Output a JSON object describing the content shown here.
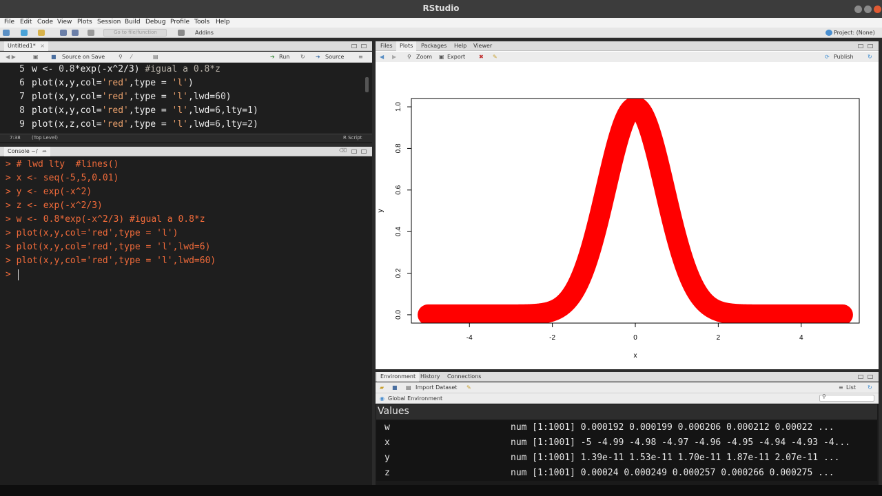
{
  "window": {
    "title": "RStudio"
  },
  "menu": [
    "File",
    "Edit",
    "Code",
    "View",
    "Plots",
    "Session",
    "Build",
    "Debug",
    "Profile",
    "Tools",
    "Help"
  ],
  "toolbar": {
    "goto_placeholder": "Go to file/function",
    "addins_label": "Addins",
    "project_label": "Project: (None)"
  },
  "editor": {
    "tab_label": "Untitled1*",
    "source_on_save_label": "Source on Save",
    "run_label": "Run",
    "source_label": "Source",
    "lines": [
      {
        "num": "5",
        "tokens": [
          {
            "t": "w <- ",
            "c": "kw"
          },
          {
            "t": "0.8",
            "c": "nm"
          },
          {
            "t": "*exp(-x^2/3) ",
            "c": "kw"
          },
          {
            "t": "#igual a 0.8*z",
            "c": "cm"
          }
        ]
      },
      {
        "num": "6",
        "tokens": [
          {
            "t": "plot(x,y,col=",
            "c": "kw"
          },
          {
            "t": "'red'",
            "c": "st"
          },
          {
            "t": ",type = ",
            "c": "kw"
          },
          {
            "t": "'l'",
            "c": "st"
          },
          {
            "t": ")",
            "c": "kw"
          }
        ]
      },
      {
        "num": "7",
        "tokens": [
          {
            "t": "plot(x,y,col=",
            "c": "kw"
          },
          {
            "t": "'red'",
            "c": "st"
          },
          {
            "t": ",type = ",
            "c": "kw"
          },
          {
            "t": "'l'",
            "c": "st"
          },
          {
            "t": ",lwd=",
            "c": "kw"
          },
          {
            "t": "60",
            "c": "nm"
          },
          {
            "t": ")",
            "c": "kw"
          }
        ]
      },
      {
        "num": "8",
        "tokens": [
          {
            "t": "plot(x,y,col=",
            "c": "kw"
          },
          {
            "t": "'red'",
            "c": "st"
          },
          {
            "t": ",type = ",
            "c": "kw"
          },
          {
            "t": "'l'",
            "c": "st"
          },
          {
            "t": ",lwd=",
            "c": "kw"
          },
          {
            "t": "6",
            "c": "nm"
          },
          {
            "t": ",lty=",
            "c": "kw"
          },
          {
            "t": "1",
            "c": "nm"
          },
          {
            "t": ")",
            "c": "kw"
          }
        ]
      },
      {
        "num": "9",
        "tokens": [
          {
            "t": "plot(x,z,col=",
            "c": "kw"
          },
          {
            "t": "'red'",
            "c": "st"
          },
          {
            "t": ",type = ",
            "c": "kw"
          },
          {
            "t": "'l'",
            "c": "st"
          },
          {
            "t": ",lwd=",
            "c": "kw"
          },
          {
            "t": "6",
            "c": "nm"
          },
          {
            "t": ",lty=",
            "c": "kw"
          },
          {
            "t": "2",
            "c": "nm"
          },
          {
            "t": ")",
            "c": "kw"
          }
        ]
      }
    ],
    "status_position": "7:38",
    "status_scope": "(Top Level)",
    "status_type": "R Script"
  },
  "console": {
    "tab_label": "Console ~/",
    "lines": [
      "> # lwd lty  #lines()",
      "> x <- seq(-5,5,0.01)",
      "> y <- exp(-x^2)",
      "> z <- exp(-x^2/3)",
      "> w <- 0.8*exp(-x^2/3) #igual a 0.8*z",
      "> plot(x,y,col='red',type = 'l')",
      "> plot(x,y,col='red',type = 'l',lwd=6)",
      "> plot(x,y,col='red',type = 'l',lwd=60)",
      "> "
    ]
  },
  "viewer": {
    "tabs": [
      "Files",
      "Plots",
      "Packages",
      "Help",
      "Viewer"
    ],
    "active_tab": "Plots",
    "zoom_label": "Zoom",
    "export_label": "Export",
    "publish_label": "Publish"
  },
  "chart_data": {
    "type": "line",
    "function": "y = exp(-x^2)",
    "x_range": [
      -5,
      5
    ],
    "x_step": 0.01,
    "xlabel": "x",
    "ylabel": "y",
    "xlim": [
      -5.4,
      5.4
    ],
    "ylim": [
      -0.04,
      1.04
    ],
    "x_ticks": [
      "-4",
      "-2",
      "0",
      "2",
      "4"
    ],
    "y_ticks": [
      "0.0",
      "0.2",
      "0.4",
      "0.6",
      "0.8",
      "1.0"
    ],
    "color": "#ff0000",
    "line_width": 60
  },
  "environment": {
    "tabs": [
      "Environment",
      "History",
      "Connections"
    ],
    "active_tab": "Environment",
    "import_label": "Import Dataset",
    "list_label": "List",
    "scope_label": "Global Environment",
    "values_header": "Values",
    "rows": [
      {
        "name": "w",
        "value": "num [1:1001] 0.000192 0.000199 0.000206 0.000212 0.00022 ..."
      },
      {
        "name": "x",
        "value": "num [1:1001] -5 -4.99 -4.98 -4.97 -4.96 -4.95 -4.94 -4.93 -4..."
      },
      {
        "name": "y",
        "value": "num [1:1001] 1.39e-11 1.53e-11 1.70e-11 1.87e-11 2.07e-11 ..."
      },
      {
        "name": "z",
        "value": "num [1:1001] 0.00024 0.000249 0.000257 0.000266 0.000275 ..."
      }
    ]
  }
}
